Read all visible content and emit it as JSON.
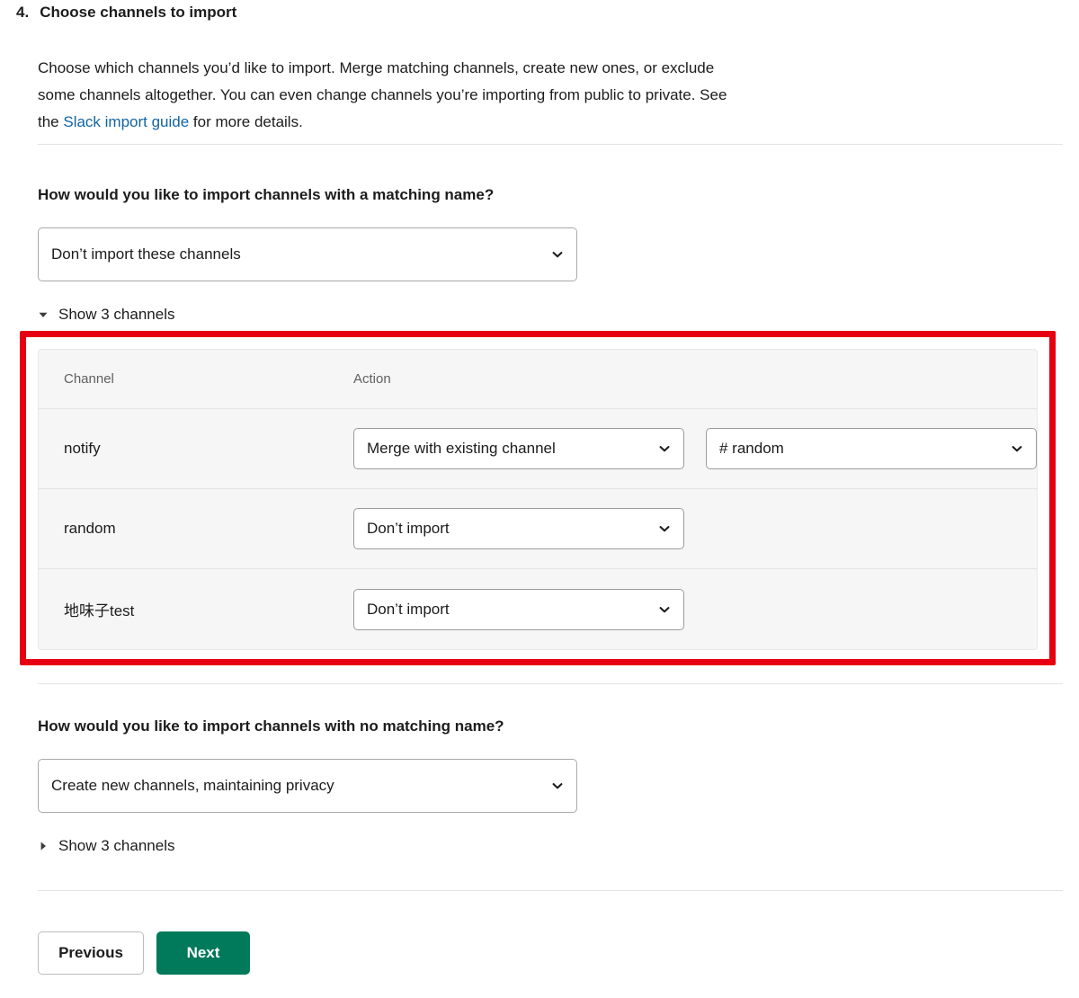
{
  "step": {
    "number": "4.",
    "title": "Choose channels to import",
    "intro_before_link": "Choose which channels you’d like to import. Merge matching channels, create new ones, or exclude some channels altogether. You can even change channels you’re importing from public to private. See the ",
    "intro_link": "Slack import guide",
    "intro_after_link": " for more details."
  },
  "matching_section": {
    "question": "How would you like to import channels with a matching name?",
    "select_value": "Don’t import these channels",
    "toggle_label": "Show 3 channels",
    "toggle_state": "expanded"
  },
  "table": {
    "headers": {
      "channel": "Channel",
      "action": "Action"
    },
    "rows": [
      {
        "channel": "notify",
        "action": "Merge with existing channel",
        "target": "# random",
        "has_target": true
      },
      {
        "channel": "random",
        "action": "Don’t import",
        "target": "",
        "has_target": false
      },
      {
        "channel": "地味子test",
        "action": "Don’t import",
        "target": "",
        "has_target": false
      }
    ]
  },
  "nomatching_section": {
    "question": "How would you like to import channels with no matching name?",
    "select_value": "Create new channels, maintaining privacy",
    "toggle_label": "Show 3 channels",
    "toggle_state": "collapsed"
  },
  "footer": {
    "previous_label": "Previous",
    "next_label": "Next"
  },
  "icons": {
    "chevron_down": "chevron-down-icon",
    "triangle_down": "triangle-down-icon",
    "triangle_right": "triangle-right-icon"
  },
  "colors": {
    "link": "#1264a3",
    "primary_button": "#007a5a",
    "highlight_border": "#e60012",
    "table_background": "#f6f6f6",
    "text": "#1d1c1d",
    "muted_text": "#616061"
  }
}
